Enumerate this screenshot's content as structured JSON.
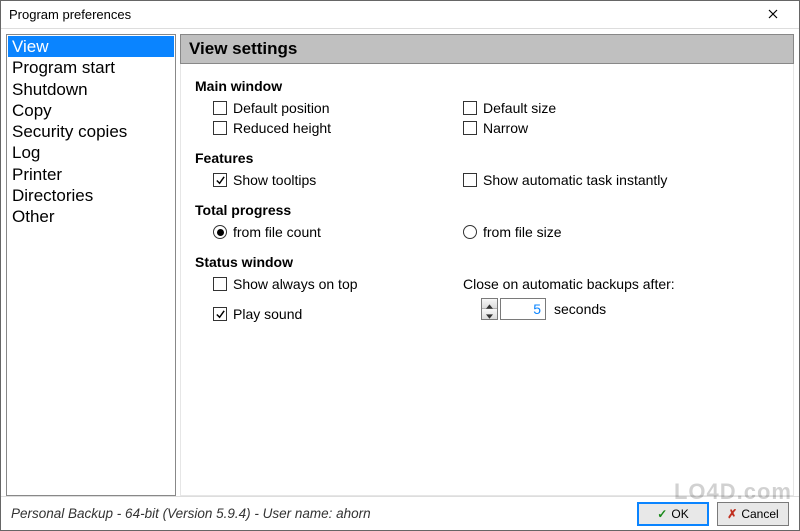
{
  "window": {
    "title": "Program preferences",
    "close_icon": "close-icon"
  },
  "sidebar": {
    "items": [
      {
        "label": "View",
        "selected": true
      },
      {
        "label": "Program start",
        "selected": false
      },
      {
        "label": "Shutdown",
        "selected": false
      },
      {
        "label": "Copy",
        "selected": false
      },
      {
        "label": "Security copies",
        "selected": false
      },
      {
        "label": "Log",
        "selected": false
      },
      {
        "label": "Printer",
        "selected": false
      },
      {
        "label": "Directories",
        "selected": false
      },
      {
        "label": "Other",
        "selected": false
      }
    ]
  },
  "panel": {
    "title": "View settings",
    "sections": {
      "main_window": {
        "label": "Main window",
        "default_position": {
          "label": "Default position",
          "checked": false
        },
        "default_size": {
          "label": "Default size",
          "checked": false
        },
        "reduced_height": {
          "label": "Reduced height",
          "checked": false
        },
        "narrow": {
          "label": "Narrow",
          "checked": false
        }
      },
      "features": {
        "label": "Features",
        "show_tooltips": {
          "label": "Show tooltips",
          "checked": true
        },
        "show_auto_task": {
          "label": "Show automatic task instantly",
          "checked": false
        }
      },
      "total_progress": {
        "label": "Total progress",
        "from_file_count": {
          "label": "from file count",
          "checked": true
        },
        "from_file_size": {
          "label": "from file size",
          "checked": false
        }
      },
      "status_window": {
        "label": "Status window",
        "always_on_top": {
          "label": "Show always on top",
          "checked": false
        },
        "play_sound": {
          "label": "Play sound",
          "checked": true
        },
        "close_after_label": "Close on automatic backups after:",
        "close_after_value": "5",
        "close_after_unit": "seconds"
      }
    }
  },
  "footer": {
    "status": "Personal Backup - 64-bit (Version 5.9.4) - User name: ahorn",
    "ok_label": "OK",
    "cancel_label": "Cancel"
  },
  "watermark": "LO4D.com",
  "colors": {
    "accent": "#0a84ff",
    "header_bg": "#c0c0c0"
  }
}
